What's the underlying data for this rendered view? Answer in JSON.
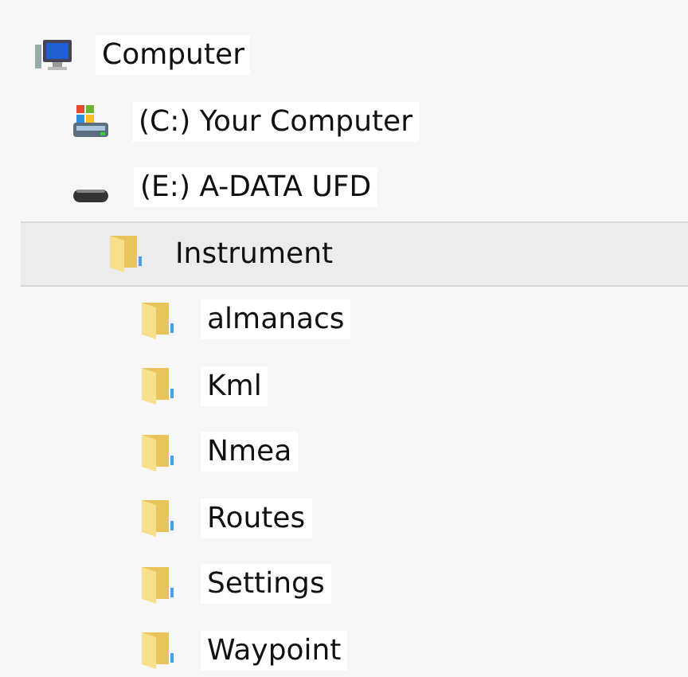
{
  "tree": [
    {
      "label": "Computer",
      "kind": "computer",
      "selected": false,
      "children": [
        {
          "label": "(C:) Your Computer",
          "kind": "system-drive",
          "selected": false
        },
        {
          "label": "(E:) A-DATA UFD",
          "kind": "removable-drive",
          "selected": false,
          "children": [
            {
              "label": "Instrument",
              "kind": "folder",
              "selected": true,
              "children": [
                {
                  "label": "almanacs",
                  "kind": "folder",
                  "selected": false
                },
                {
                  "label": "Kml",
                  "kind": "folder",
                  "selected": false
                },
                {
                  "label": "Nmea",
                  "kind": "folder",
                  "selected": false
                },
                {
                  "label": "Routes",
                  "kind": "folder",
                  "selected": false
                },
                {
                  "label": "Settings",
                  "kind": "folder",
                  "selected": false
                },
                {
                  "label": "Waypoint",
                  "kind": "folder",
                  "selected": false
                }
              ]
            }
          ]
        }
      ]
    }
  ]
}
